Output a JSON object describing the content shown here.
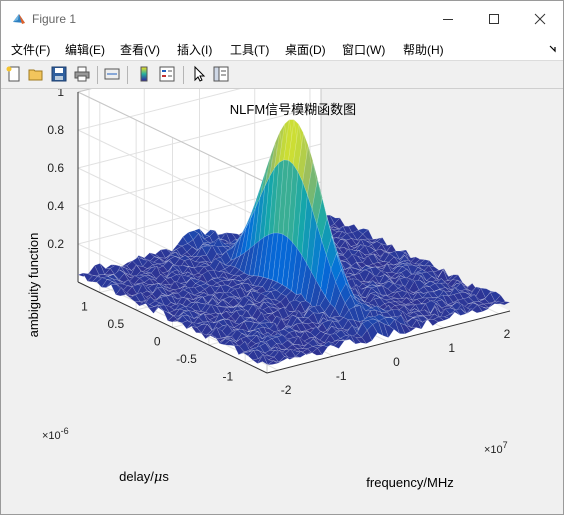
{
  "window": {
    "title": "Figure 1",
    "minimize_icon": "minimize-icon",
    "maximize_icon": "maximize-icon",
    "close_icon": "close-icon"
  },
  "menu": {
    "items": [
      "文件(F)",
      "编辑(E)",
      "查看(V)",
      "插入(I)",
      "工具(T)",
      "桌面(D)",
      "窗口(W)",
      "帮助(H)"
    ]
  },
  "toolbar": {
    "icons": [
      "new-figure-icon",
      "open-file-icon",
      "save-icon",
      "print-icon",
      "link-plot-icon",
      "colorbar-icon",
      "legend-icon",
      "pointer-icon",
      "property-inspector-icon"
    ]
  },
  "chart_data": {
    "type": "surface3d",
    "title": "NLFM信号模糊函数图",
    "xlabel": "frequency/MHz",
    "ylabel": "delay/$\\mu$s",
    "zlabel": "ambiguity function",
    "x_ticks": [
      "-2",
      "-1",
      "0",
      "1",
      "2"
    ],
    "x_exponent": "×10",
    "x_exponent_power": "7",
    "y_ticks": [
      "1",
      "0.5",
      "0",
      "-0.5",
      "-1"
    ],
    "y_exponent": "×10",
    "y_exponent_power": "-6",
    "z_ticks": [
      "1",
      "0.8",
      "0.6",
      "0.4",
      "0.2"
    ],
    "xlim": [
      -22000000.0,
      22000000.0
    ],
    "ylim": [
      -1.3e-06,
      1.3e-06
    ],
    "zlim": [
      0,
      1
    ],
    "peak": {
      "x": 0,
      "y": 0,
      "z": 0.93
    },
    "grid": true,
    "colormap": "parula"
  }
}
